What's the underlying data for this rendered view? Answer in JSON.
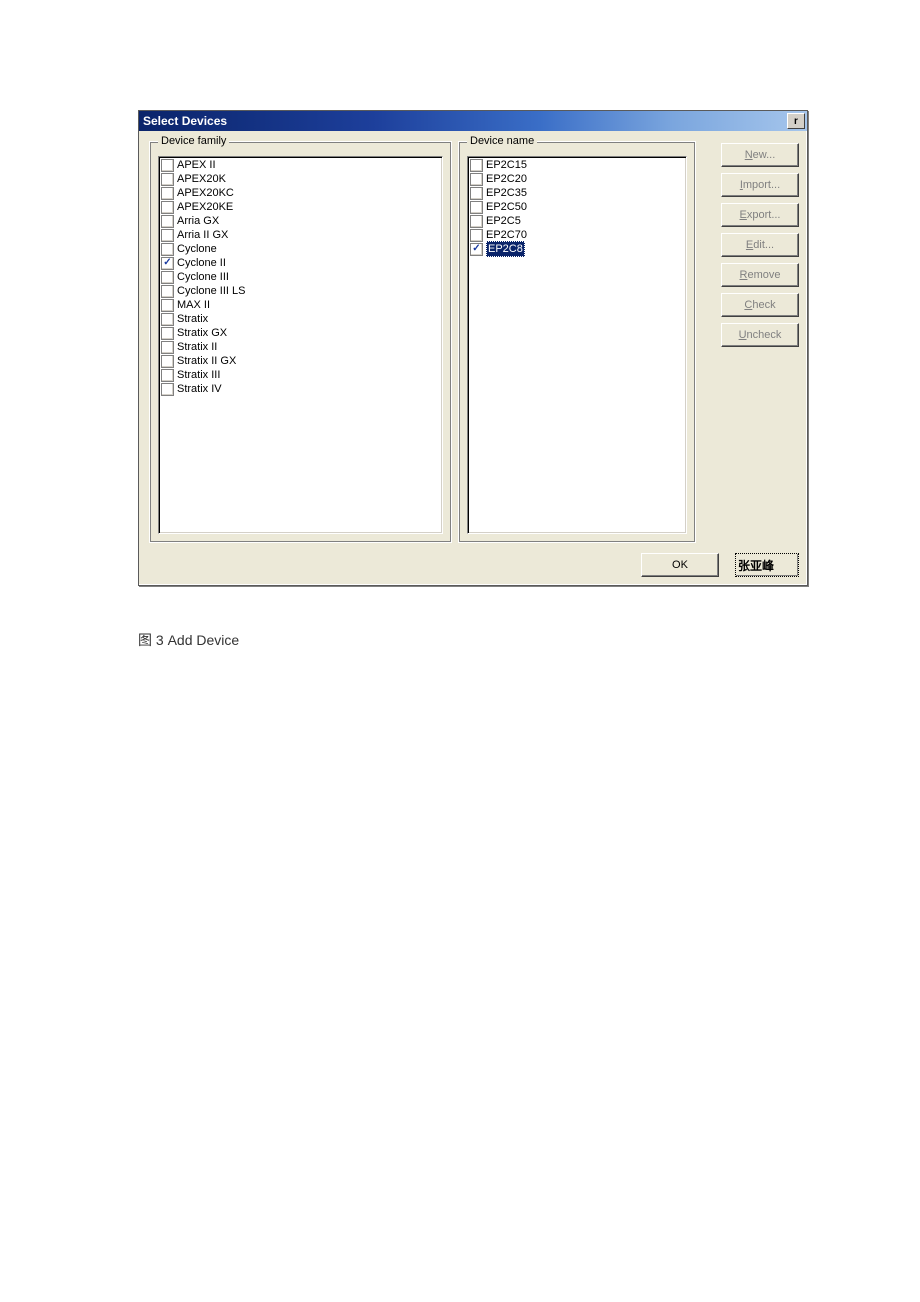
{
  "dialog": {
    "title": "Select Devices",
    "close_glyph": "✕"
  },
  "groups": {
    "family_legend": "Device family",
    "name_legend": "Device name"
  },
  "families": [
    {
      "label": "APEX II",
      "checked": false
    },
    {
      "label": "APEX20K",
      "checked": false
    },
    {
      "label": "APEX20KC",
      "checked": false
    },
    {
      "label": "APEX20KE",
      "checked": false
    },
    {
      "label": "Arria GX",
      "checked": false
    },
    {
      "label": "Arria II GX",
      "checked": false
    },
    {
      "label": "Cyclone",
      "checked": false
    },
    {
      "label": "Cyclone II",
      "checked": true
    },
    {
      "label": "Cyclone III",
      "checked": false
    },
    {
      "label": "Cyclone III LS",
      "checked": false
    },
    {
      "label": "MAX II",
      "checked": false
    },
    {
      "label": "Stratix",
      "checked": false
    },
    {
      "label": "Stratix GX",
      "checked": false
    },
    {
      "label": "Stratix II",
      "checked": false
    },
    {
      "label": "Stratix II GX",
      "checked": false
    },
    {
      "label": "Stratix III",
      "checked": false
    },
    {
      "label": "Stratix IV",
      "checked": false
    }
  ],
  "devices": [
    {
      "label": "EP2C15",
      "checked": false,
      "selected": false
    },
    {
      "label": "EP2C20",
      "checked": false,
      "selected": false
    },
    {
      "label": "EP2C35",
      "checked": false,
      "selected": false
    },
    {
      "label": "EP2C50",
      "checked": false,
      "selected": false
    },
    {
      "label": "EP2C5",
      "checked": false,
      "selected": false
    },
    {
      "label": "EP2C70",
      "checked": false,
      "selected": false
    },
    {
      "label": "EP2C8",
      "checked": true,
      "selected": true
    }
  ],
  "buttons": {
    "new": {
      "u": "N",
      "rest": "ew..."
    },
    "import": {
      "u": "I",
      "rest": "mport..."
    },
    "export": {
      "u": "E",
      "rest": "xport..."
    },
    "edit": {
      "u": "E",
      "rest": "dit..."
    },
    "remove": {
      "u": "R",
      "rest": "emove"
    },
    "check": {
      "u": "C",
      "rest": "heck"
    },
    "uncheck": {
      "u": "U",
      "rest": "ncheck"
    },
    "ok": "OK"
  },
  "watermark": "张亚峰",
  "caption": "图 3 Add Device"
}
